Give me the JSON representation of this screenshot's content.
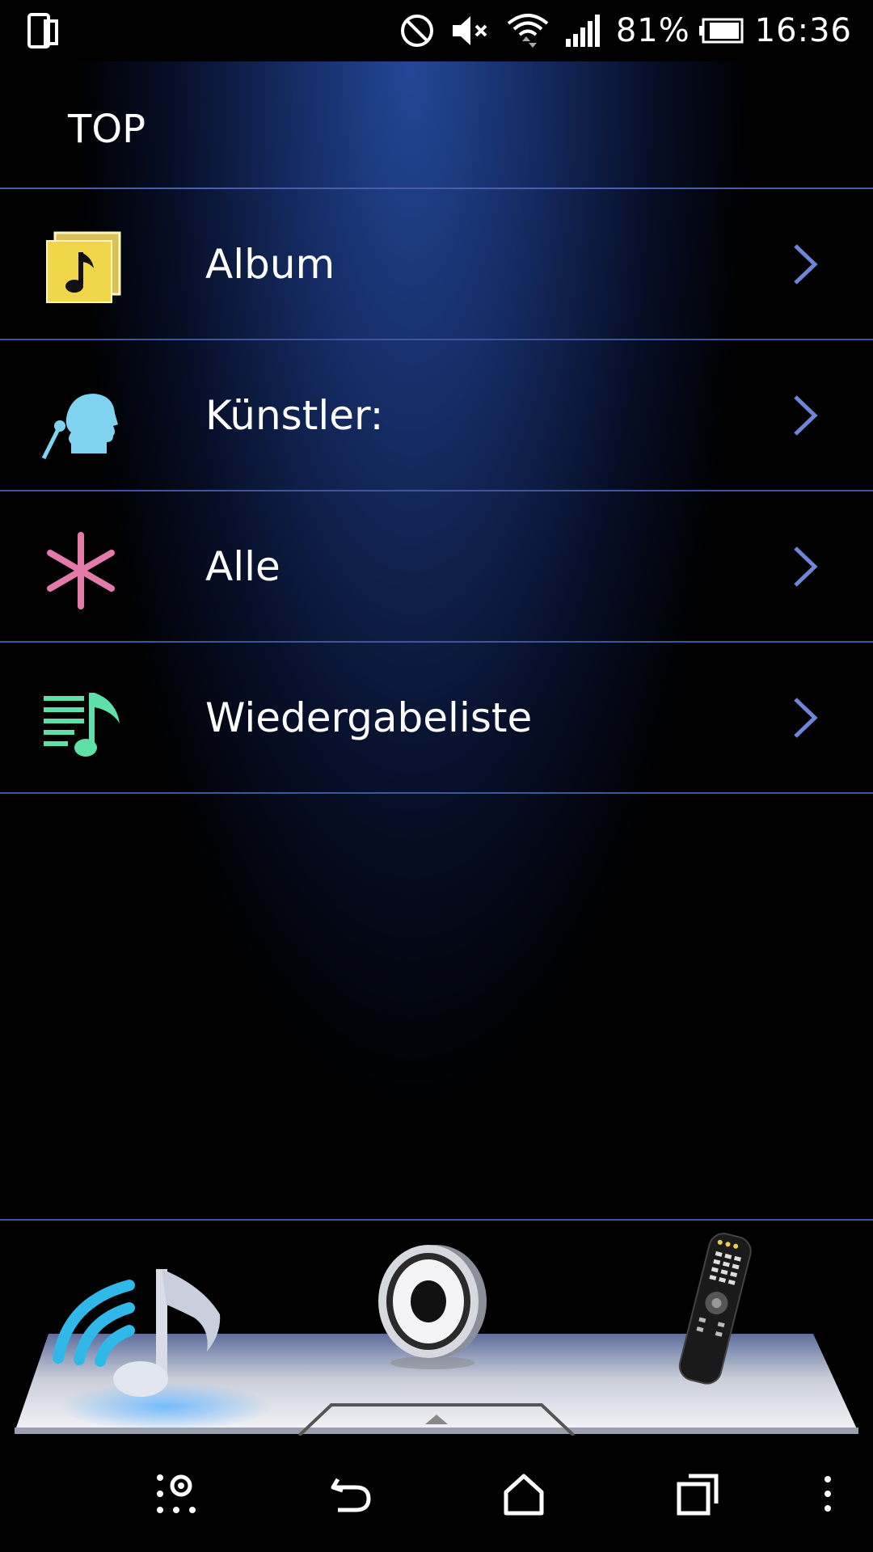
{
  "status_bar": {
    "battery_percent": "81%",
    "time": "16:36",
    "icons": [
      "screen-mirror-icon",
      "do-not-disturb-icon",
      "muted-icon",
      "wifi-icon",
      "signal-icon",
      "battery-icon"
    ]
  },
  "header": {
    "title": "TOP"
  },
  "menu": {
    "items": [
      {
        "label": "Album",
        "icon": "album-icon"
      },
      {
        "label": "Künstler:",
        "icon": "artist-icon"
      },
      {
        "label": "Alle",
        "icon": "all-icon"
      },
      {
        "label": "Wiedergabeliste",
        "icon": "playlist-icon"
      }
    ]
  },
  "dock": {
    "items": [
      "music-stream-icon",
      "speaker-icon",
      "remote-control-icon"
    ]
  },
  "nav": {
    "items": [
      "screenshot-settings-icon",
      "back-icon",
      "home-icon",
      "recent-apps-icon",
      "more-icon"
    ]
  },
  "colors": {
    "accent_line": "#4a5ea8",
    "chevron": "#6f86d8",
    "album_icon": "#f2d64a",
    "artist_icon": "#7fd3ef",
    "all_icon": "#e47aaa",
    "playlist_icon": "#5fe0a8"
  }
}
